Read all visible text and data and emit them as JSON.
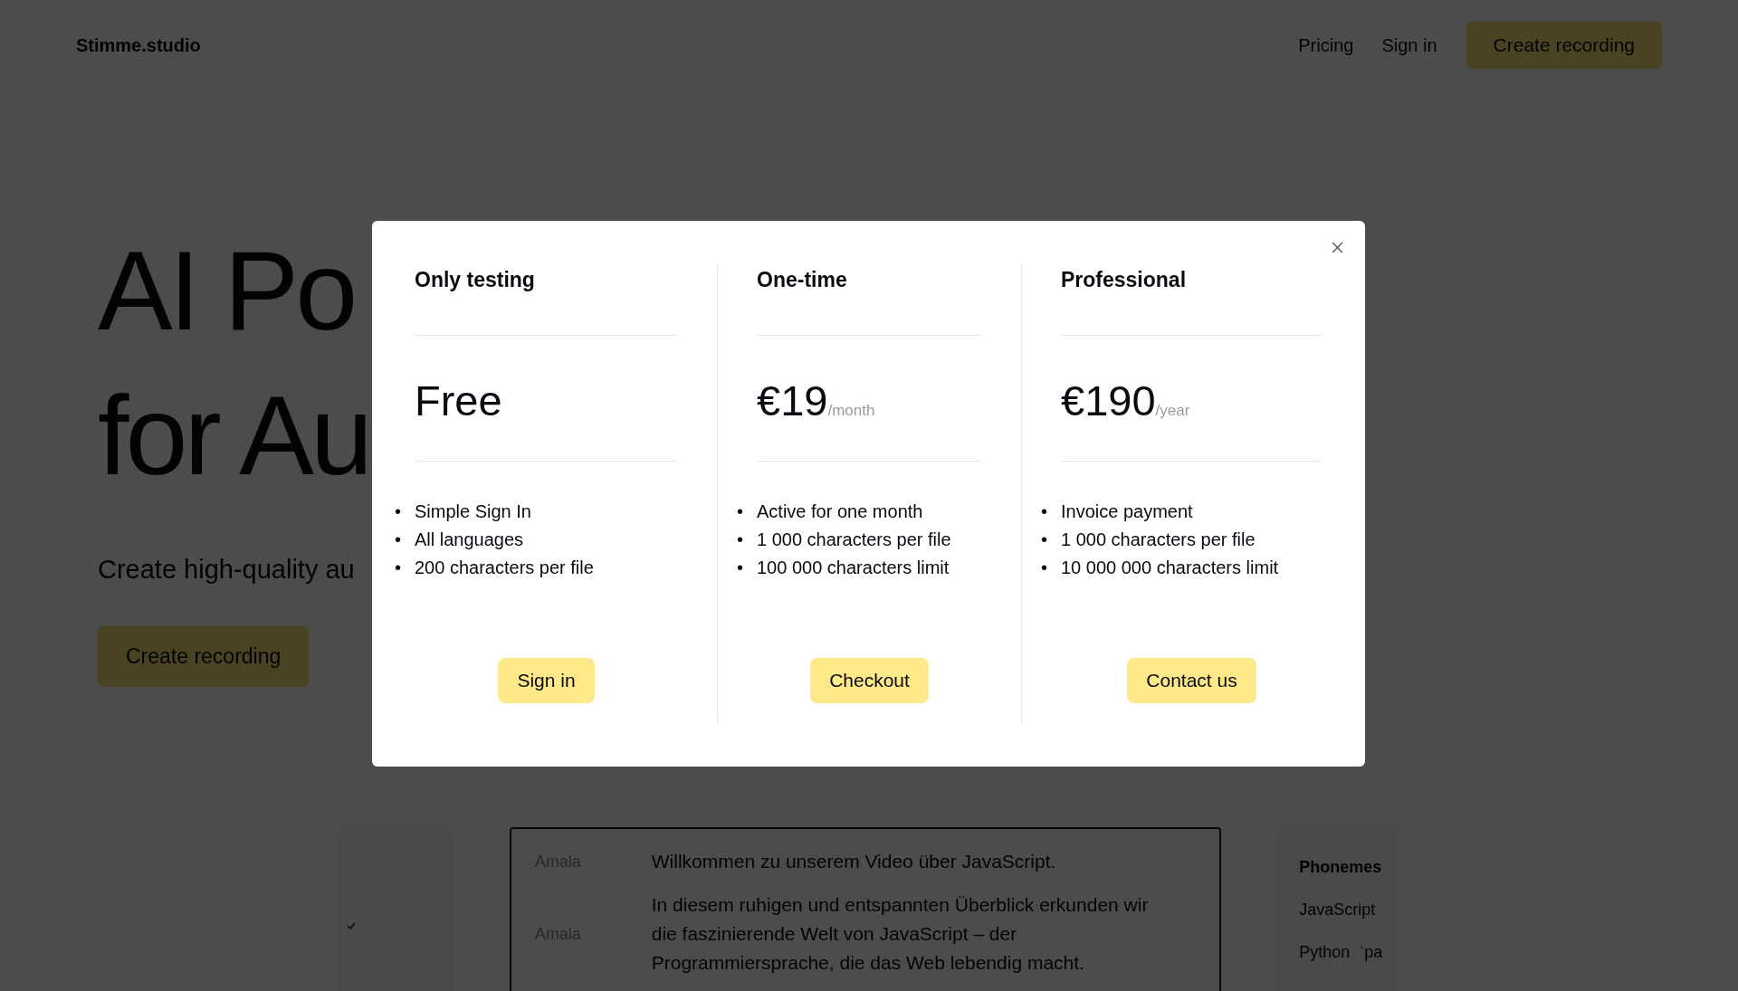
{
  "nav": {
    "logo": "Stimme.studio",
    "links": [
      "Pricing",
      "Sign in"
    ],
    "cta": "Create recording"
  },
  "hero": {
    "title_lines": [
      "AI Po",
      "for Au"
    ],
    "subtitle": "Create high-quality au",
    "cta": "Create recording"
  },
  "editor": {
    "rows": [
      {
        "speaker": "Amala",
        "text": "Willkommen zu unserem Video über JavaScript."
      },
      {
        "speaker": "Amala",
        "text": "In diesem ruhigen und entspannten Überblick erkunden wir die faszinierende Welt von JavaScript – der Programmiersprache, die das Web lebendig macht."
      }
    ]
  },
  "phonemes": {
    "title": "Phonemes",
    "items": [
      {
        "word": "JavaScript"
      },
      {
        "word": "Python",
        "ipa": "ˈpa"
      }
    ]
  },
  "modal": {
    "bullet": "•",
    "plans": [
      {
        "name": "Only testing",
        "price": "Free",
        "features": [
          "Simple Sign In",
          "All languages",
          "200 characters per file"
        ],
        "button": "Sign in"
      },
      {
        "name": "One-time",
        "price": "€19",
        "period": "/month",
        "features": [
          "Active for one month",
          "1 000 characters per file",
          "100 000 characters limit"
        ],
        "button": "Checkout"
      },
      {
        "name": "Professional",
        "price": "€190",
        "period": "/year",
        "features": [
          "Invoice payment",
          "1 000 characters per file",
          "10 000 000 characters limit"
        ],
        "button": "Contact us"
      }
    ]
  }
}
